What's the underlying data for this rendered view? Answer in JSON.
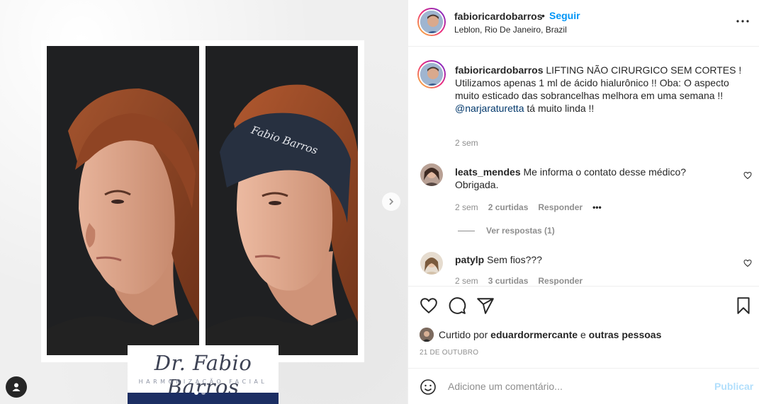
{
  "post": {
    "username": "fabioricardobarros",
    "separator": "•",
    "follow_label": "Seguir",
    "location": "Leblon, Rio De Janeiro, Brazil",
    "more_icon": "more-horizontal-icon"
  },
  "media": {
    "brand_name": "Dr. Fabio Barros",
    "brand_sub": "HARMONIZAÇÃO FACIAL",
    "headband_text": "Fabio Barros",
    "carousel_total": 2,
    "carousel_active": 1,
    "next_icon": "chevron-right-icon",
    "tag_icon": "user-tag-icon"
  },
  "caption": {
    "username": "fabioricardobarros",
    "text": "LIFTING NÃO CIRURGICO SEM CORTES ! Utilizamos apenas 1 ml de ácido hialurônico !! Oba: O aspecto muito esticado das sobrancelhas melhora em uma semana !!",
    "mention": "@narjaraturetta",
    "mention_text": " tá muito linda !!",
    "time": "2 sem"
  },
  "comments": [
    {
      "username": "leats_mendes",
      "text": "Me informa o contato desse médico? Obrigada.",
      "time": "2 sem",
      "likes": "2 curtidas",
      "reply_label": "Responder",
      "more": "•••",
      "view_replies": "Ver respostas (1)"
    },
    {
      "username": "patylp",
      "text": "Sem fios???",
      "time": "2 sem",
      "likes": "3 curtidas",
      "reply_label": "Responder"
    }
  ],
  "actions": {
    "like_icon": "heart-icon",
    "comment_icon": "comment-icon",
    "share_icon": "send-icon",
    "save_icon": "bookmark-icon",
    "liked_by_prefix": "Curtido por",
    "liked_by_user": "eduardormercante",
    "liked_by_suffix": "e",
    "liked_by_others": "outras pessoas",
    "date": "21 DE OUTUBRO"
  },
  "add_comment": {
    "emoji_icon": "emoji-icon",
    "placeholder": "Adicione um comentário...",
    "publish_label": "Publicar"
  },
  "colors": {
    "accent": "#0095f6",
    "publish_disabled": "#b2dffc",
    "text": "#262626",
    "muted": "#8e8e8e",
    "mention": "#00376b"
  }
}
